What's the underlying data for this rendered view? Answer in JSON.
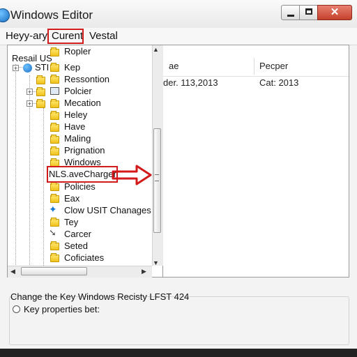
{
  "window": {
    "title": "Windows Editor",
    "buttons": {
      "close_glyph": "✕"
    }
  },
  "menu": [
    "Heyy-ary",
    "Curent",
    "Vestal"
  ],
  "tree": {
    "root": "Resail US",
    "second": "STI",
    "items": [
      "Ropler",
      "Kep",
      "Ressontion",
      "Polcier",
      "Mecation",
      "Heley",
      "Have",
      "Maling",
      "Prignation",
      "Windows",
      "NLS.aveCharger",
      "Policies",
      "Eax",
      "Clow USIT Chanages",
      "Tey",
      "Carcer",
      "Seted",
      "Coficiates"
    ]
  },
  "list": {
    "columns": [
      "ae",
      "Pecper"
    ],
    "rows": [
      [
        "der. 113,2013",
        "Cat: 2013"
      ]
    ]
  },
  "status": {
    "description": "Change the Key Windows Recisty LFST 424",
    "radio_label": "Key properties bet:"
  },
  "colors": {
    "accent": "#d21a1a",
    "folder": "#f0c21c"
  },
  "icons": {
    "app": "globe-icon",
    "folder": "folder-icon",
    "arrow": "arrow-right-icon",
    "scroll_up": "chevron-up-icon",
    "scroll_down": "chevron-down-icon"
  }
}
